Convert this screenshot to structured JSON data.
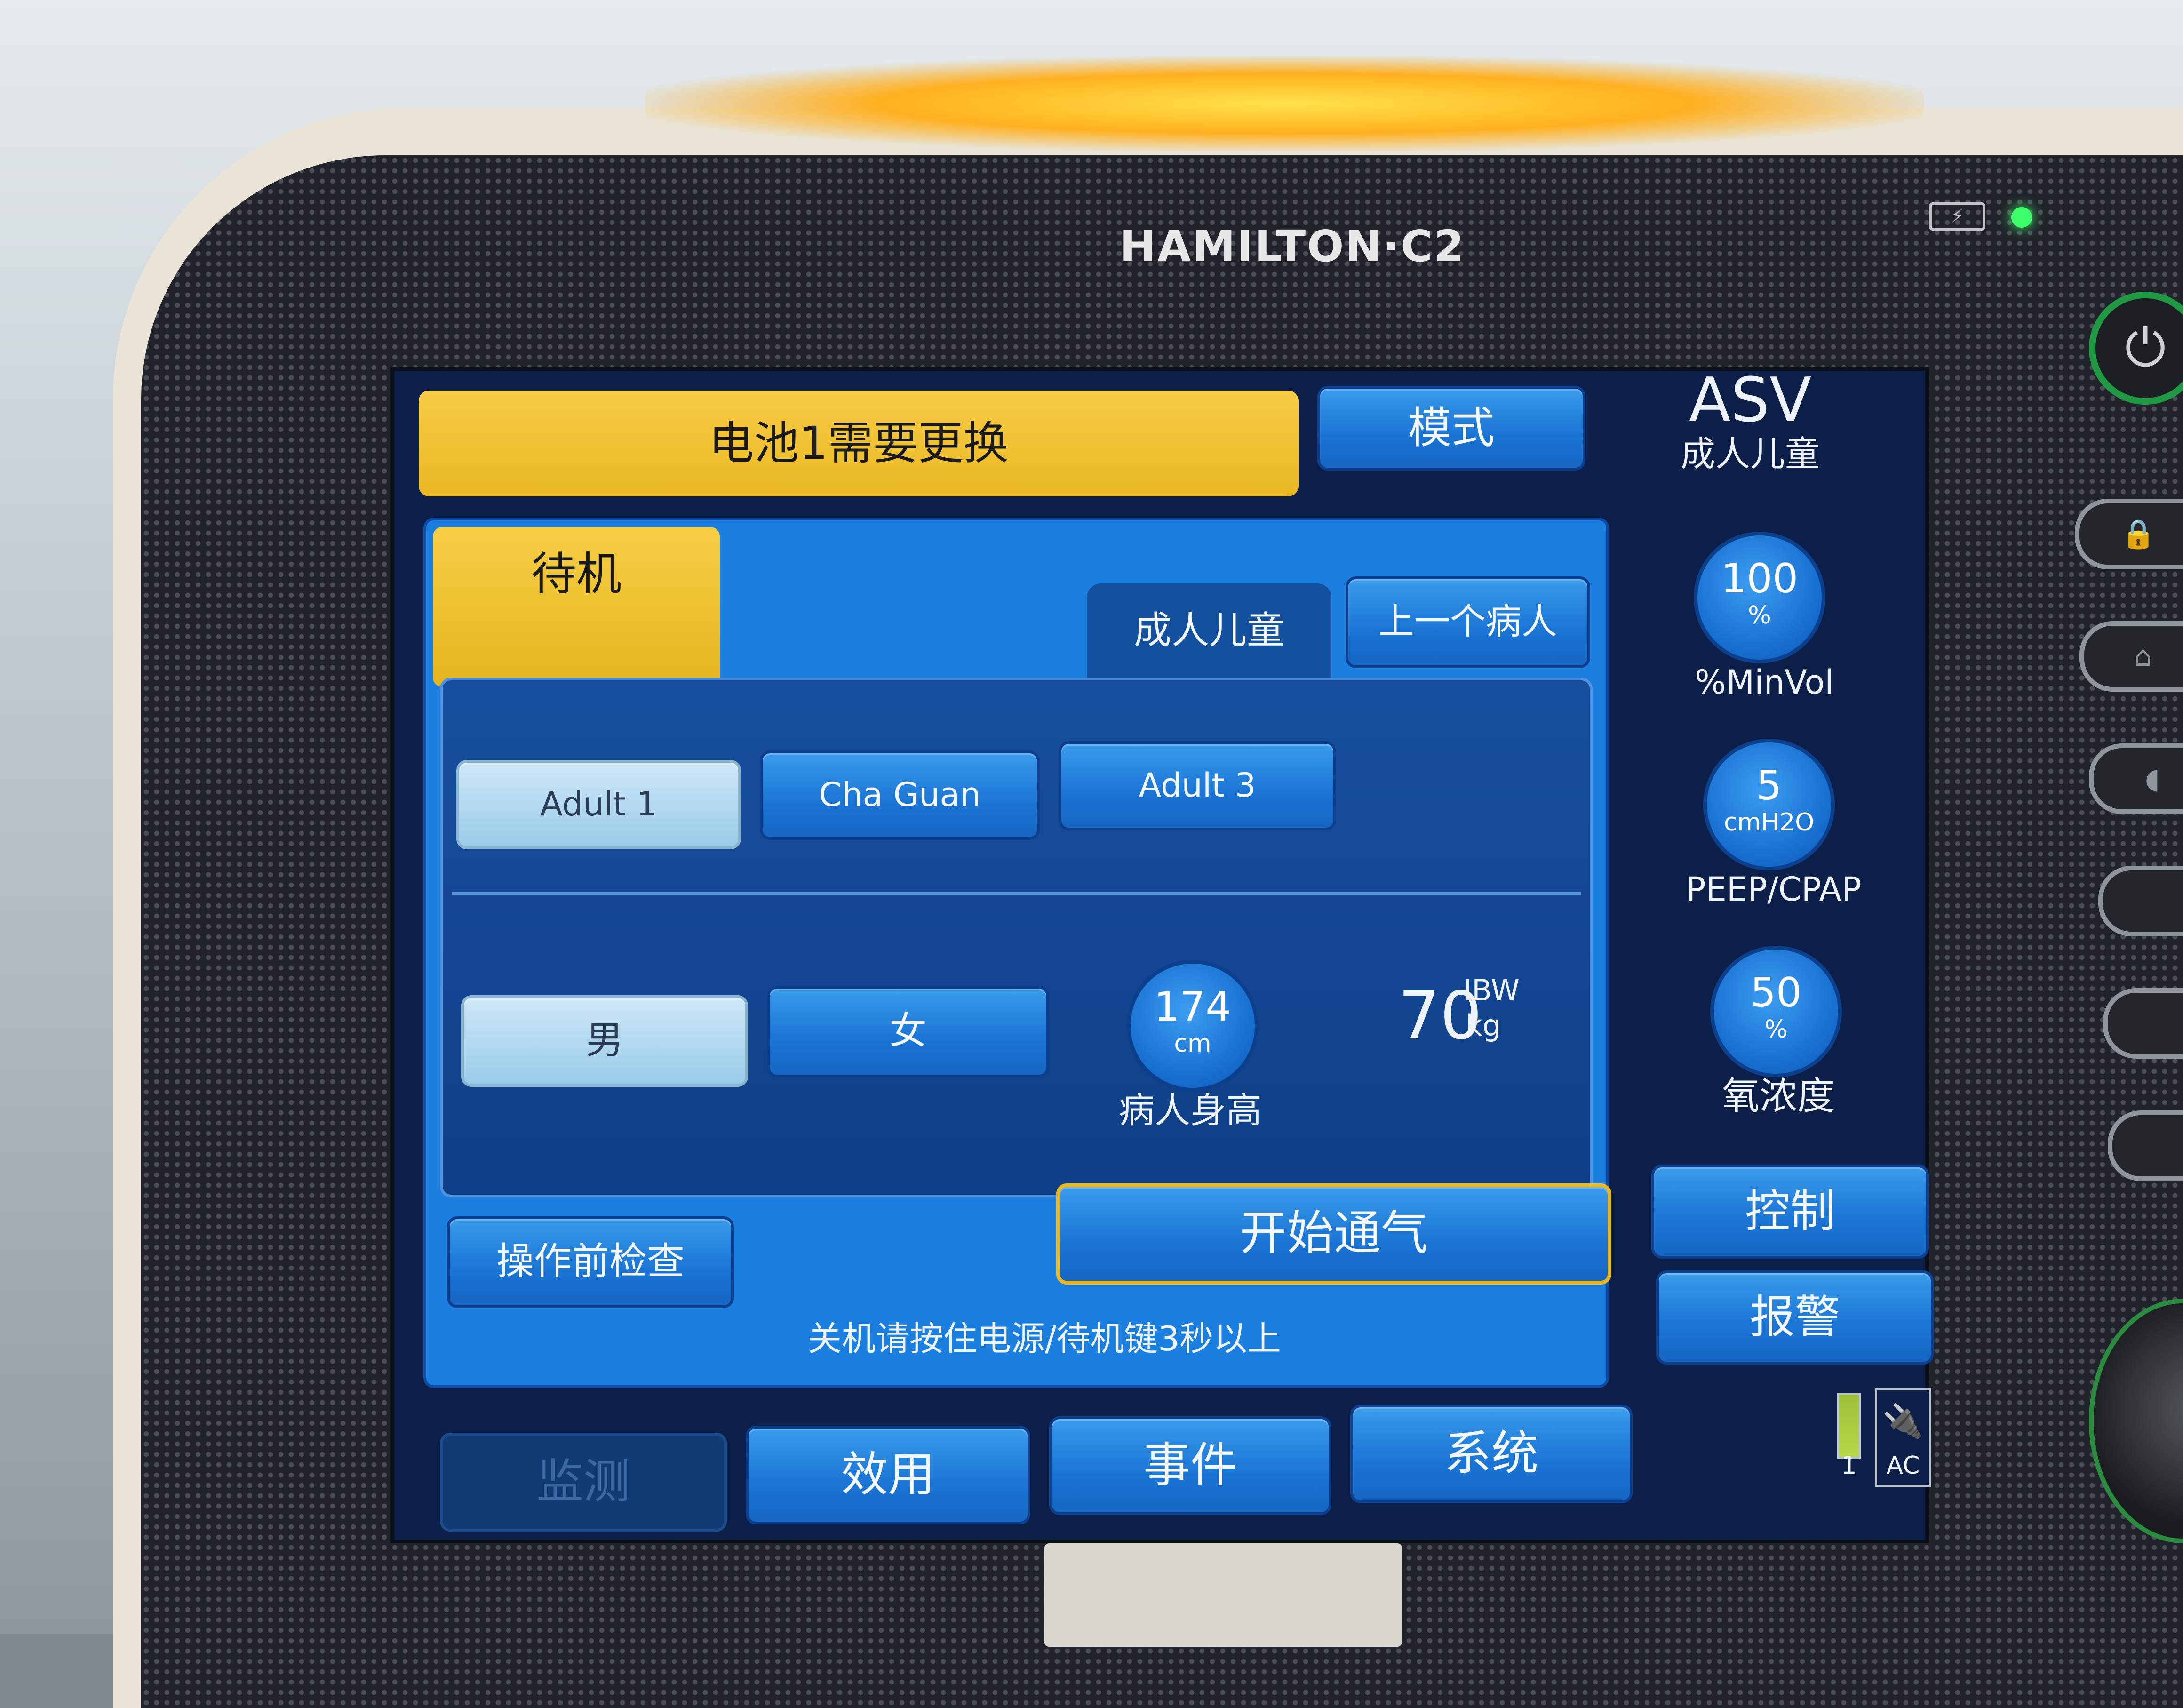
{
  "device": {
    "brand": "HAMILTON·C2"
  },
  "header": {
    "alarm_message": "电池1需要更换",
    "mode_button": "模式",
    "current_mode": "ASV",
    "patient_group": "成人儿童"
  },
  "panel": {
    "status": "待机",
    "tabs": [
      {
        "label": "成人儿童",
        "active": true
      },
      {
        "label": "上一个病人",
        "active": false
      }
    ],
    "presets": [
      {
        "label": "Adult 1",
        "selected": true
      },
      {
        "label": "Cha Guan",
        "selected": false
      },
      {
        "label": "Adult 3",
        "selected": false
      }
    ],
    "sex": [
      {
        "label": "男",
        "selected": true
      },
      {
        "label": "女",
        "selected": false
      }
    ],
    "height": {
      "value": "174",
      "unit": "cm",
      "label": "病人身高"
    },
    "ibw": {
      "value": "70",
      "label": "IBW",
      "unit": "kg"
    },
    "precheck_button": "操作前检查",
    "start_button": "开始通气",
    "hint": "关机请按住电源/待机键3秒以上"
  },
  "controls": [
    {
      "value": "100",
      "unit": "%",
      "label": "%MinVol"
    },
    {
      "value": "5",
      "unit": "cmH2O",
      "label": "PEEP/CPAP"
    },
    {
      "value": "50",
      "unit": "%",
      "label": "氧浓度"
    }
  ],
  "side_buttons": {
    "control": "控制",
    "alarm": "报警"
  },
  "bottom_tabs": [
    {
      "label": "监测",
      "disabled": true
    },
    {
      "label": "效用",
      "disabled": false
    },
    {
      "label": "事件",
      "disabled": false
    },
    {
      "label": "系统",
      "disabled": false
    }
  ],
  "power_status": {
    "battery_number": "1",
    "ac_label": "AC"
  },
  "colors": {
    "alarm_yellow": "#f7cc45",
    "button_blue": "#1a74d4",
    "selected_light": "#99cbe9",
    "screen_background": "#0c1f49",
    "led_green": "#3dff6a"
  },
  "icons": [
    "battery-icon",
    "status-led-icon",
    "power-icon",
    "lock-icon",
    "home-o2-icon",
    "lung-icon",
    "plug-icon"
  ]
}
